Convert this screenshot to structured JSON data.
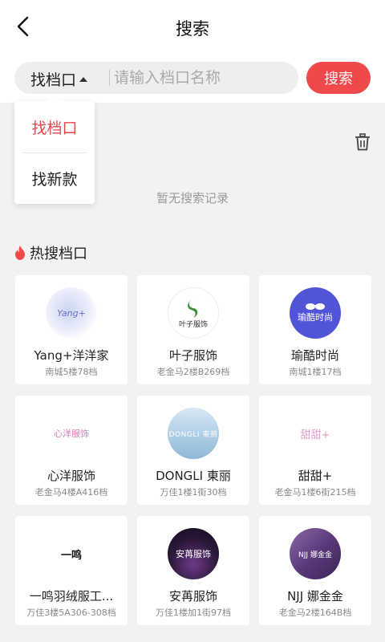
{
  "header": {
    "title": "搜索"
  },
  "search": {
    "type_label": "找档口",
    "placeholder": "请输入档口名称",
    "button_label": "搜索"
  },
  "dropdown": {
    "options": [
      {
        "label": "找档口",
        "selected": true
      },
      {
        "label": "找新款",
        "selected": false
      }
    ]
  },
  "history": {
    "empty_text": "暂无搜索记录"
  },
  "hot": {
    "title": "热搜档口",
    "shops": [
      {
        "name": "Yang+洋洋家",
        "location": "南城5楼78档",
        "logo_text": "Yang+"
      },
      {
        "name": "叶子服饰",
        "location": "老金马2楼B269档",
        "logo_text": "叶子服饰"
      },
      {
        "name": "瑜酷时尚",
        "location": "南城1楼17档",
        "logo_text": "瑜酷时尚"
      },
      {
        "name": "心洋服饰",
        "location": "老金马4楼A416档",
        "logo_text": "心洋服饰"
      },
      {
        "name": "DONGLI 東丽",
        "location": "万佳1楼1街30档",
        "logo_text": "DONGLI 東丽"
      },
      {
        "name": "甜甜+",
        "location": "老金马1楼6街215档",
        "logo_text": "甜甜+"
      },
      {
        "name": "一鸣羽绒服工...",
        "location": "万佳3楼5A306-308档",
        "logo_text": "一鸣"
      },
      {
        "name": "安苒服饰",
        "location": "万佳1楼加1街97档",
        "logo_text": "安苒服饰"
      },
      {
        "name": "NJJ 娜金金",
        "location": "老金马2楼164B档",
        "logo_text": "NJJ 娜金金"
      }
    ]
  },
  "colors": {
    "accent": "#f0494b",
    "background": "#f2f2f2"
  }
}
